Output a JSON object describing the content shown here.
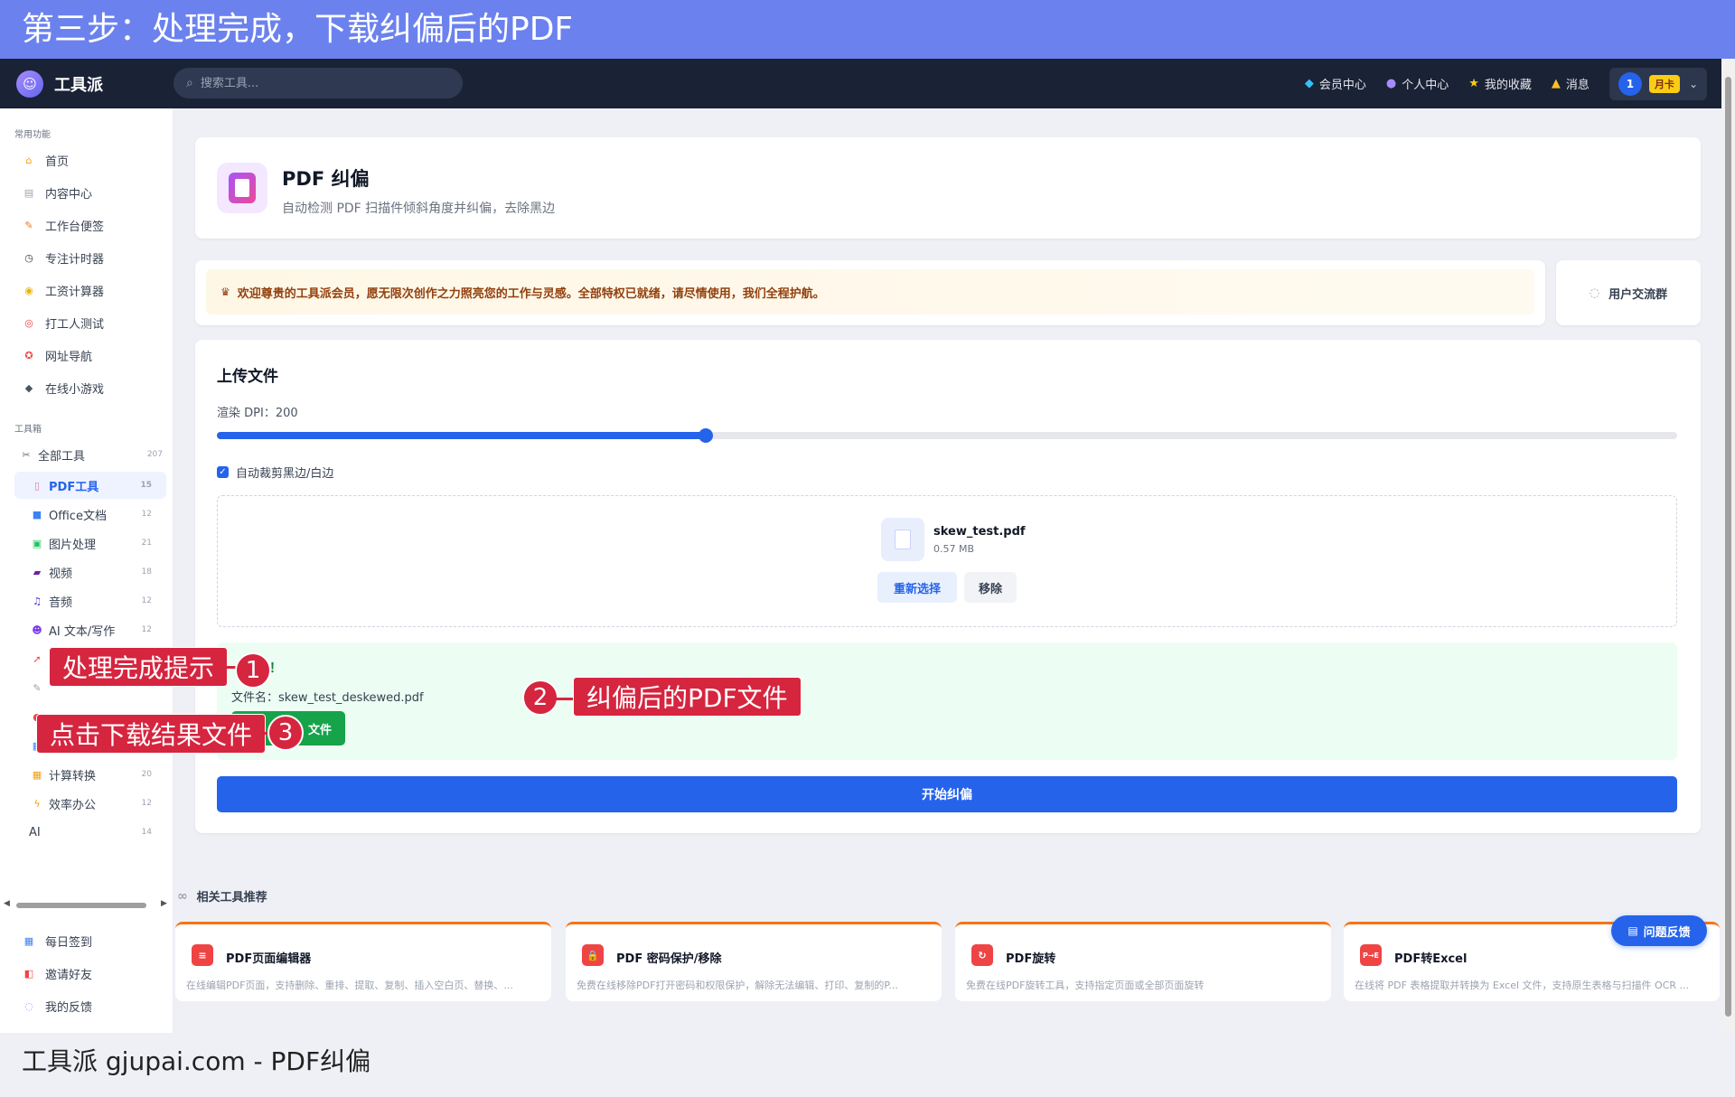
{
  "banner": {
    "text": "第三步：处理完成，下载纠偏后的PDF"
  },
  "navbar": {
    "logo_text": "工具派",
    "search_placeholder": "搜索工具...",
    "links": [
      "会员中心",
      "个人中心",
      "我的收藏",
      "消息"
    ],
    "user_avatar": "1",
    "user_badge": "月卡"
  },
  "sidebar": {
    "section_common": "常用功能",
    "common_items": [
      "首页",
      "内容中心",
      "工作台便签",
      "专注计时器",
      "工资计算器",
      "打工人测试",
      "网址导航",
      "在线小游戏"
    ],
    "section_tools": "工具箱",
    "categories": [
      {
        "label": "全部工具",
        "count": "207"
      },
      {
        "label": "PDF工具",
        "count": "15"
      },
      {
        "label": "Office文档",
        "count": "12"
      },
      {
        "label": "图片处理",
        "count": "21"
      },
      {
        "label": "视频",
        "count": "18"
      },
      {
        "label": "音频",
        "count": "12"
      },
      {
        "label": "AI 文本/写作",
        "count": "12"
      },
      {
        "label": "计算转换",
        "count": "20"
      },
      {
        "label": "效率办公",
        "count": "12"
      },
      {
        "label": "AI",
        "count": "14"
      }
    ],
    "bottom_items": [
      "每日签到",
      "邀请好友",
      "我的反馈"
    ]
  },
  "tool": {
    "title": "PDF 纠偏",
    "description": "自动检测 PDF 扫描件倾斜角度并纠偏，去除黑边"
  },
  "welcome": {
    "text": "欢迎尊贵的工具派会员，愿无限次创作之力照亮您的工作与灵感。全部特权已就绪，请尽情使用，我们全程护航。",
    "group_button": "用户交流群"
  },
  "upload": {
    "title": "上传文件",
    "dpi_label": "渲染 DPI：200",
    "dpi_fraction": 0.335,
    "auto_crop_label": "自动裁剪黑边/白边",
    "auto_crop_checked": true,
    "file_name": "skew_test.pdf",
    "file_size": "0.57 MB",
    "reselect_button": "重新选择",
    "remove_button": "移除"
  },
  "result": {
    "title_fragment": "成！",
    "file_label": "文件名：skew_test_deskewed.pdf",
    "download_fragment": "文件"
  },
  "start_button": "开始纠偏",
  "related": {
    "title": "相关工具推荐",
    "cards": [
      {
        "title": "PDF页面编辑器",
        "desc": "在线编辑PDF页面，支持删除、重排、提取、复制、插入空白页、替换、...",
        "icon": "≡"
      },
      {
        "title": "PDF 密码保护/移除",
        "desc": "免费在线移除PDF打开密码和权限保护，解除无法编辑、打印、复制的P...",
        "icon": "🔒"
      },
      {
        "title": "PDF旋转",
        "desc": "免费在线PDF旋转工具，支持指定页面或全部页面旋转",
        "icon": "↻"
      },
      {
        "title": "PDF转Excel",
        "desc": "在线将 PDF 表格提取并转换为 Excel 文件，支持原生表格与扫描件 OCR ...",
        "icon": "P→E"
      }
    ]
  },
  "feedback_button": "问题反馈",
  "annotations": {
    "callout1": "处理完成提示",
    "num1": "1",
    "callout2": "纠偏后的PDF文件",
    "num2": "2",
    "callout3": "点击下载结果文件",
    "num3": "3"
  },
  "caption": "工具派 gjupai.com - PDF纠偏"
}
